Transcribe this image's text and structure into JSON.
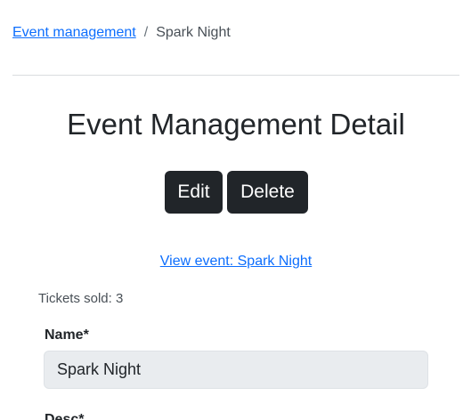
{
  "breadcrumb": {
    "parent_label": "Event management",
    "separator": "/",
    "current_label": "Spark Night"
  },
  "page": {
    "title": "Event Management Detail"
  },
  "actions": {
    "edit_label": "Edit",
    "delete_label": "Delete"
  },
  "view_link": {
    "label": "View event: Spark Night"
  },
  "tickets": {
    "text": "Tickets sold: 3"
  },
  "form": {
    "name": {
      "label": "Name*",
      "value": "Spark Night"
    },
    "desc": {
      "label": "Desc*"
    }
  },
  "colors": {
    "link": "#0d6efd",
    "button_bg": "#212529",
    "input_bg": "#e9ecef",
    "divider": "#d9dcdf"
  }
}
